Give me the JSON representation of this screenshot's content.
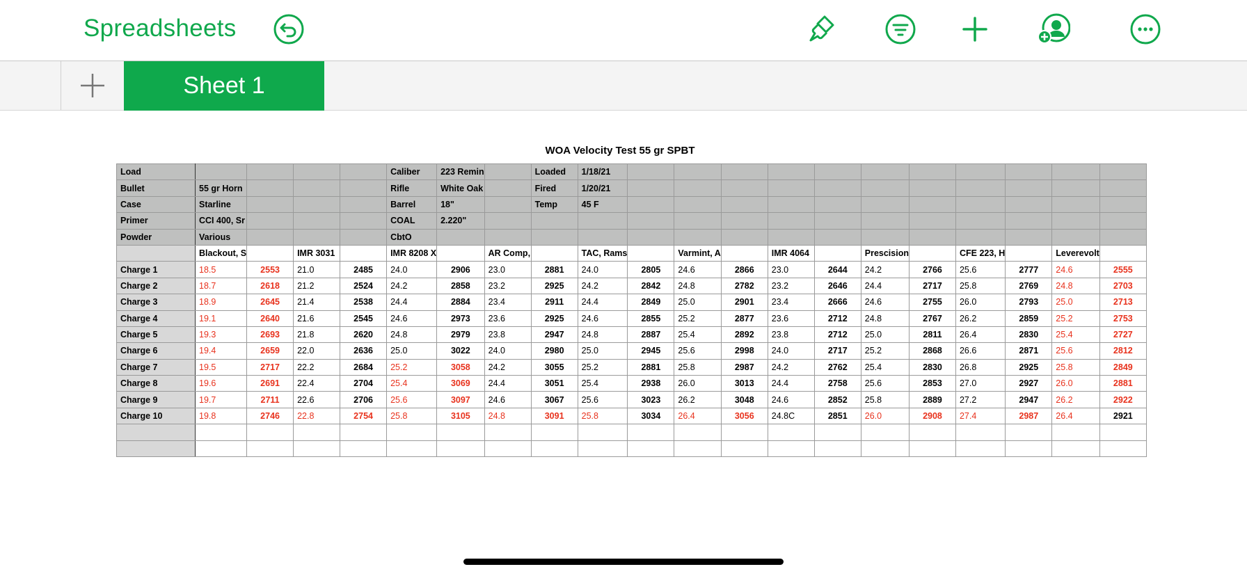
{
  "app": {
    "title": "Spreadsheets",
    "accent": "#10a84c",
    "icons": [
      "undo-icon",
      "format-brush-icon",
      "filter-icon",
      "add-icon",
      "collaborate-icon",
      "more-icon"
    ]
  },
  "tabs": {
    "add_icon": "plus-icon",
    "active": "Sheet 1"
  },
  "sheet": {
    "title": "WOA Velocity Test 55 gr SPBT",
    "header_rows": [
      [
        "Load",
        "",
        "",
        "",
        "",
        "Caliber",
        "223 Remin",
        "",
        "Loaded",
        "1/18/21",
        "",
        "",
        "",
        "",
        "",
        "",
        "",
        "",
        "",
        "",
        ""
      ],
      [
        "Bullet",
        "55 gr Horn",
        "",
        "",
        "",
        "Rifle",
        "White Oak",
        "",
        "Fired",
        "1/20/21",
        "",
        "",
        "",
        "",
        "",
        "",
        "",
        "",
        "",
        "",
        ""
      ],
      [
        "Case",
        "Starline",
        "",
        "",
        "",
        "Barrel",
        "18\"",
        "",
        "Temp",
        "45 F",
        "",
        "",
        "",
        "",
        "",
        "",
        "",
        "",
        "",
        "",
        ""
      ],
      [
        "Primer",
        "CCI 400, Sr",
        "",
        "",
        "",
        "COAL",
        "2.220\"",
        "",
        "",
        "",
        "",
        "",
        "",
        "",
        "",
        "",
        "",
        "",
        "",
        "",
        ""
      ],
      [
        "Powder",
        "Various",
        "",
        "",
        "",
        "CbtO",
        "",
        "",
        "",
        "",
        "",
        "",
        "",
        "",
        "",
        "",
        "",
        "",
        "",
        "",
        ""
      ]
    ],
    "column_header": [
      "",
      "Blackout, S",
      "",
      "IMR 3031",
      "",
      "IMR 8208 X",
      "",
      "AR Comp,",
      "",
      "TAC, Rams",
      "",
      "Varmint, A",
      "",
      "IMR 4064",
      "",
      "Prescision",
      "",
      "CFE 223, H",
      "",
      "Leverevolt",
      ""
    ],
    "charges": [
      {
        "label": "Charge 1",
        "cells": [
          "18.5",
          "2553",
          "21.0",
          "2485",
          "24.0",
          "2906",
          "23.0",
          "2881",
          "24.0",
          "2805",
          "24.6",
          "2866",
          "23.0",
          "2644",
          "24.2",
          "2766",
          "25.6",
          "2777",
          "24.6",
          "2555"
        ],
        "red": [
          0,
          1,
          18,
          19
        ]
      },
      {
        "label": "Charge 2",
        "cells": [
          "18.7",
          "2618",
          "21.2",
          "2524",
          "24.2",
          "2858",
          "23.2",
          "2925",
          "24.2",
          "2842",
          "24.8",
          "2782",
          "23.2",
          "2646",
          "24.4",
          "2717",
          "25.8",
          "2769",
          "24.8",
          "2703"
        ],
        "red": [
          0,
          1,
          18,
          19
        ]
      },
      {
        "label": "Charge 3",
        "cells": [
          "18.9",
          "2645",
          "21.4",
          "2538",
          "24.4",
          "2884",
          "23.4",
          "2911",
          "24.4",
          "2849",
          "25.0",
          "2901",
          "23.4",
          "2666",
          "24.6",
          "2755",
          "26.0",
          "2793",
          "25.0",
          "2713"
        ],
        "red": [
          0,
          1,
          18,
          19
        ]
      },
      {
        "label": "Charge 4",
        "cells": [
          "19.1",
          "2640",
          "21.6",
          "2545",
          "24.6",
          "2973",
          "23.6",
          "2925",
          "24.6",
          "2855",
          "25.2",
          "2877",
          "23.6",
          "2712",
          "24.8",
          "2767",
          "26.2",
          "2859",
          "25.2",
          "2753"
        ],
        "red": [
          0,
          1,
          18,
          19
        ]
      },
      {
        "label": "Charge 5",
        "cells": [
          "19.3",
          "2693",
          "21.8",
          "2620",
          "24.8",
          "2979",
          "23.8",
          "2947",
          "24.8",
          "2887",
          "25.4",
          "2892",
          "23.8",
          "2712",
          "25.0",
          "2811",
          "26.4",
          "2830",
          "25.4",
          "2727"
        ],
        "red": [
          0,
          1,
          18,
          19
        ]
      },
      {
        "label": "Charge 6",
        "cells": [
          "19.4",
          "2659",
          "22.0",
          "2636",
          "25.0",
          "3022",
          "24.0",
          "2980",
          "25.0",
          "2945",
          "25.6",
          "2998",
          "24.0",
          "2717",
          "25.2",
          "2868",
          "26.6",
          "2871",
          "25.6",
          "2812"
        ],
        "red": [
          0,
          1,
          18,
          19
        ]
      },
      {
        "label": "Charge 7",
        "cells": [
          "19.5",
          "2717",
          "22.2",
          "2684",
          "25.2",
          "3058",
          "24.2",
          "3055",
          "25.2",
          "2881",
          "25.8",
          "2987",
          "24.2",
          "2762",
          "25.4",
          "2830",
          "26.8",
          "2925",
          "25.8",
          "2849"
        ],
        "red": [
          0,
          1,
          4,
          5,
          18,
          19
        ]
      },
      {
        "label": "Charge 8",
        "cells": [
          "19.6",
          "2691",
          "22.4",
          "2704",
          "25.4",
          "3069",
          "24.4",
          "3051",
          "25.4",
          "2938",
          "26.0",
          "3013",
          "24.4",
          "2758",
          "25.6",
          "2853",
          "27.0",
          "2927",
          "26.0",
          "2881"
        ],
        "red": [
          0,
          1,
          4,
          5,
          18,
          19
        ]
      },
      {
        "label": "Charge 9",
        "cells": [
          "19.7",
          "2711",
          "22.6",
          "2706",
          "25.6",
          "3097",
          "24.6",
          "3067",
          "25.6",
          "3023",
          "26.2",
          "3048",
          "24.6",
          "2852",
          "25.8",
          "2889",
          "27.2",
          "2947",
          "26.2",
          "2922"
        ],
        "red": [
          0,
          1,
          4,
          5,
          18,
          19
        ]
      },
      {
        "label": "Charge 10",
        "cells": [
          "19.8",
          "2746",
          "22.8",
          "2754",
          "25.8",
          "3105",
          "24.8",
          "3091",
          "25.8",
          "3034",
          "26.4",
          "3056",
          "24.8C",
          "2851",
          "26.0",
          "2908",
          "27.4",
          "2987",
          "26.4",
          "2921"
        ],
        "red": [
          0,
          1,
          2,
          3,
          4,
          5,
          6,
          7,
          8,
          10,
          11,
          14,
          15,
          16,
          17,
          18
        ]
      }
    ],
    "empty_rows": 2
  }
}
